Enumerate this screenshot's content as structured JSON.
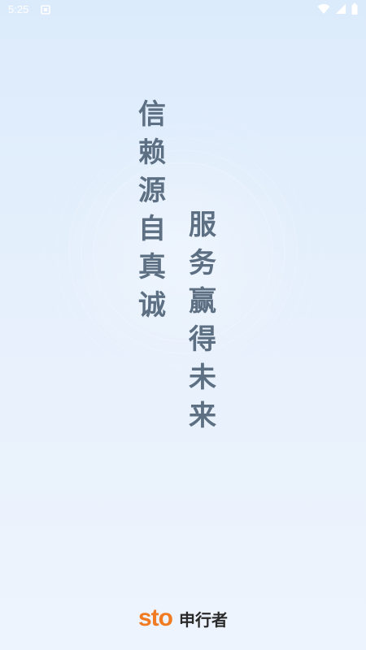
{
  "status_bar": {
    "time": "5:25",
    "icons": [
      "notification-icon",
      "wifi-icon",
      "signal-icon",
      "battery-icon"
    ]
  },
  "slogan": {
    "left_column": [
      "信",
      "赖",
      "源",
      "自",
      "真",
      "诚"
    ],
    "right_column": [
      "服",
      "务",
      "赢",
      "得",
      "未",
      "来"
    ]
  },
  "brand": {
    "logo_text": "sto",
    "name": "申行者"
  },
  "colors": {
    "slogan_text": "#5d6f82",
    "brand_orange": "#f17b20",
    "brand_name": "#2a2a2a",
    "background": "#e6f0fc"
  }
}
